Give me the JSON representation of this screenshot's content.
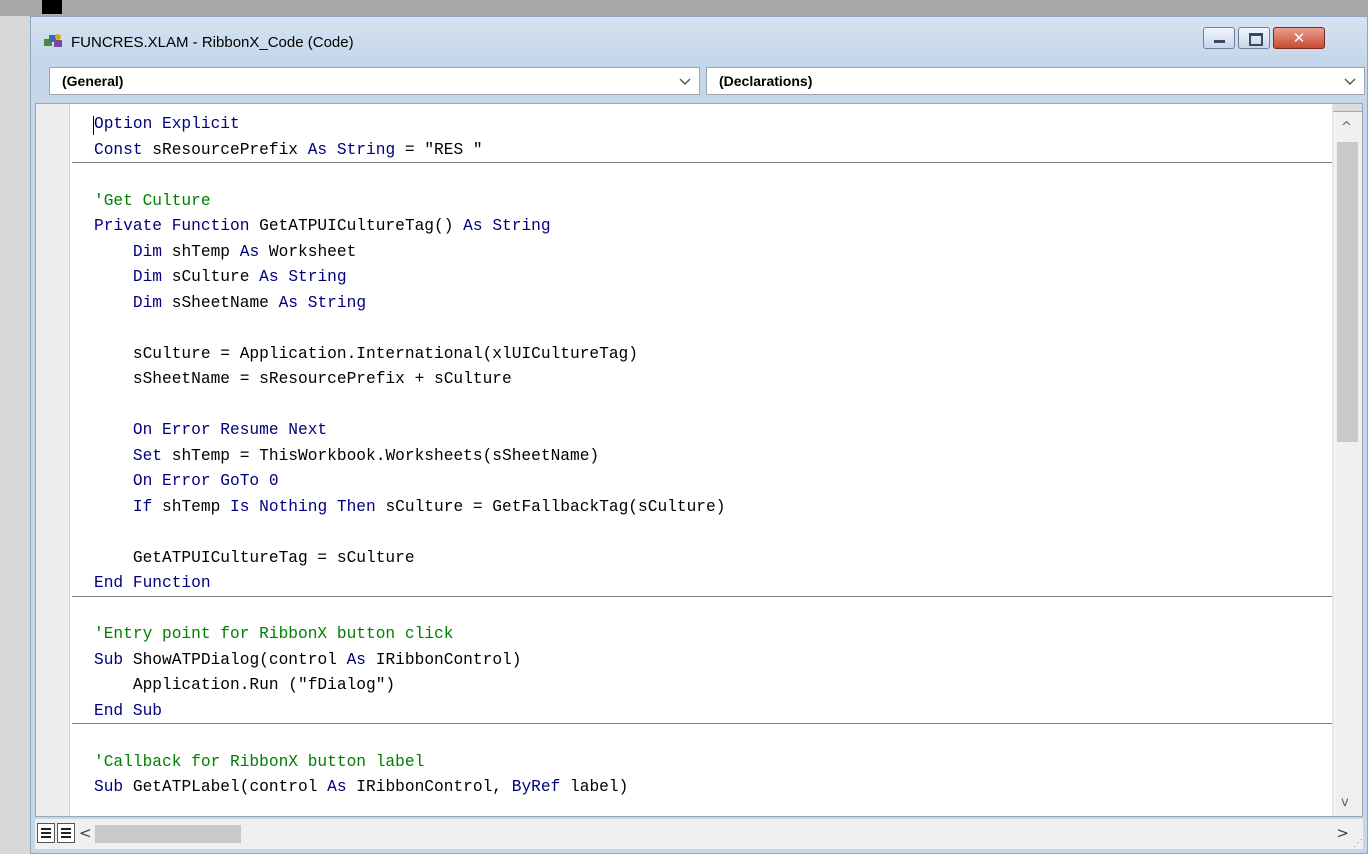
{
  "window": {
    "title": "FUNCRES.XLAM - RibbonX_Code (Code)",
    "close_symbol": "✕"
  },
  "object_combo": {
    "value": "(General)"
  },
  "procedure_combo": {
    "value": "(Declarations)"
  },
  "code_lines": [
    {
      "tokens": [
        {
          "t": "Option Explicit",
          "c": "kw"
        }
      ]
    },
    {
      "tokens": [
        {
          "t": "Const",
          "c": "kw"
        },
        {
          "t": " sResourcePrefix ",
          "c": ""
        },
        {
          "t": "As",
          "c": "kw"
        },
        {
          "t": " ",
          "c": ""
        },
        {
          "t": "String",
          "c": "kw"
        },
        {
          "t": " = \"RES \"",
          "c": ""
        }
      ]
    },
    {
      "tokens": []
    },
    {
      "tokens": [
        {
          "t": "'Get Culture",
          "c": "cm"
        }
      ]
    },
    {
      "tokens": [
        {
          "t": "Private",
          "c": "kw"
        },
        {
          "t": " ",
          "c": ""
        },
        {
          "t": "Function",
          "c": "kw"
        },
        {
          "t": " GetATPUICultureTag() ",
          "c": ""
        },
        {
          "t": "As",
          "c": "kw"
        },
        {
          "t": " ",
          "c": ""
        },
        {
          "t": "String",
          "c": "kw"
        }
      ]
    },
    {
      "tokens": [
        {
          "t": "    ",
          "c": ""
        },
        {
          "t": "Dim",
          "c": "kw"
        },
        {
          "t": " shTemp ",
          "c": ""
        },
        {
          "t": "As",
          "c": "kw"
        },
        {
          "t": " Worksheet",
          "c": ""
        }
      ]
    },
    {
      "tokens": [
        {
          "t": "    ",
          "c": ""
        },
        {
          "t": "Dim",
          "c": "kw"
        },
        {
          "t": " sCulture ",
          "c": ""
        },
        {
          "t": "As",
          "c": "kw"
        },
        {
          "t": " ",
          "c": ""
        },
        {
          "t": "String",
          "c": "kw"
        }
      ]
    },
    {
      "tokens": [
        {
          "t": "    ",
          "c": ""
        },
        {
          "t": "Dim",
          "c": "kw"
        },
        {
          "t": " sSheetName ",
          "c": ""
        },
        {
          "t": "As",
          "c": "kw"
        },
        {
          "t": " ",
          "c": ""
        },
        {
          "t": "String",
          "c": "kw"
        }
      ]
    },
    {
      "tokens": []
    },
    {
      "tokens": [
        {
          "t": "    sCulture = Application.International(xlUICultureTag)",
          "c": ""
        }
      ]
    },
    {
      "tokens": [
        {
          "t": "    sSheetName = sResourcePrefix + sCulture",
          "c": ""
        }
      ]
    },
    {
      "tokens": []
    },
    {
      "tokens": [
        {
          "t": "    ",
          "c": ""
        },
        {
          "t": "On Error Resume Next",
          "c": "kw"
        }
      ]
    },
    {
      "tokens": [
        {
          "t": "    ",
          "c": ""
        },
        {
          "t": "Set",
          "c": "kw"
        },
        {
          "t": " shTemp = ThisWorkbook.Worksheets(sSheetName)",
          "c": ""
        }
      ]
    },
    {
      "tokens": [
        {
          "t": "    ",
          "c": ""
        },
        {
          "t": "On Error GoTo 0",
          "c": "kw"
        }
      ]
    },
    {
      "tokens": [
        {
          "t": "    ",
          "c": ""
        },
        {
          "t": "If",
          "c": "kw"
        },
        {
          "t": " shTemp ",
          "c": ""
        },
        {
          "t": "Is Nothing Then",
          "c": "kw"
        },
        {
          "t": " sCulture = GetFallbackTag(sCulture)",
          "c": ""
        }
      ]
    },
    {
      "tokens": []
    },
    {
      "tokens": [
        {
          "t": "    GetATPUICultureTag = sCulture",
          "c": ""
        }
      ]
    },
    {
      "tokens": [
        {
          "t": "End Function",
          "c": "kw"
        }
      ]
    },
    {
      "tokens": []
    },
    {
      "tokens": [
        {
          "t": "'Entry point for RibbonX button click",
          "c": "cm"
        }
      ]
    },
    {
      "tokens": [
        {
          "t": "Sub",
          "c": "kw"
        },
        {
          "t": " ShowATPDialog(control ",
          "c": ""
        },
        {
          "t": "As",
          "c": "kw"
        },
        {
          "t": " IRibbonControl)",
          "c": ""
        }
      ]
    },
    {
      "tokens": [
        {
          "t": "    Application.Run (\"fDialog\")",
          "c": ""
        }
      ]
    },
    {
      "tokens": [
        {
          "t": "End Sub",
          "c": "kw"
        }
      ]
    },
    {
      "tokens": []
    },
    {
      "tokens": [
        {
          "t": "'Callback for RibbonX button label",
          "c": "cm"
        }
      ]
    },
    {
      "tokens": [
        {
          "t": "Sub",
          "c": "kw"
        },
        {
          "t": " GetATPLabel(control ",
          "c": ""
        },
        {
          "t": "As",
          "c": "kw"
        },
        {
          "t": " IRibbonControl, ",
          "c": ""
        },
        {
          "t": "ByRef",
          "c": "kw"
        },
        {
          "t": " label)",
          "c": ""
        }
      ]
    }
  ],
  "procedure_separators_after_line": [
    2,
    19,
    24
  ],
  "scrollbar": {
    "up_arrow": "^",
    "down_arrow": "v",
    "left_arrow": "<",
    "right_arrow": ">"
  },
  "colors": {
    "keyword": "#00007f",
    "comment": "#007f00",
    "text": "#000000"
  },
  "icons": {
    "app": "vba-module-icon",
    "view_procedure": "procedure-view-icon",
    "view_full": "full-module-view-icon"
  }
}
